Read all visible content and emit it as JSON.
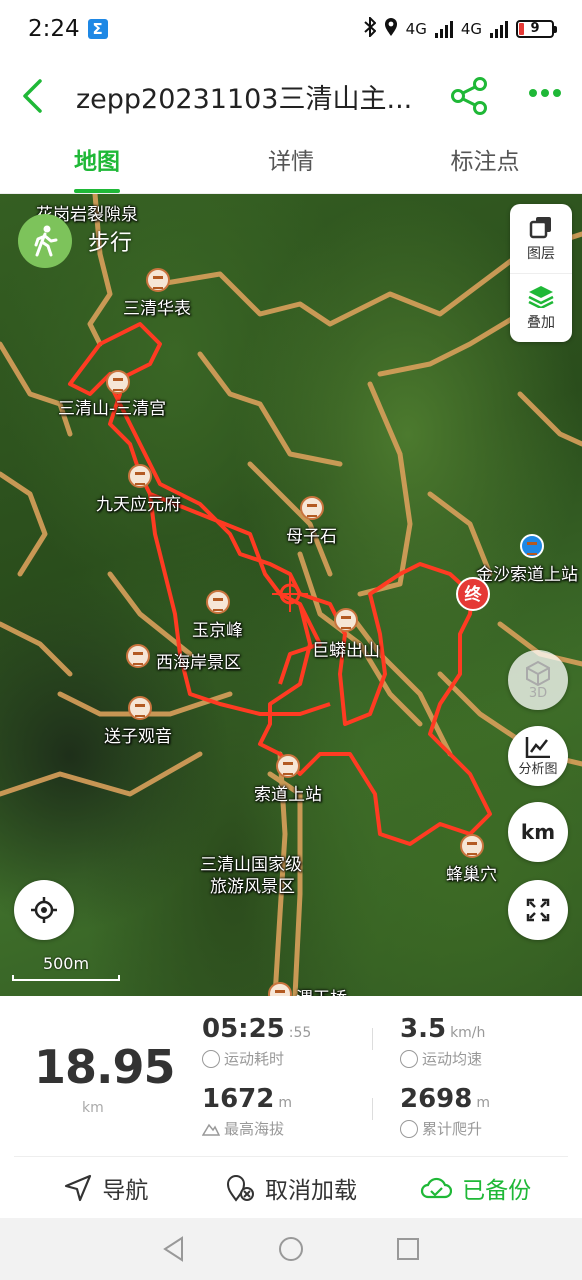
{
  "status_bar": {
    "time": "2:24",
    "net1": "4G",
    "net2": "4G",
    "battery": "9"
  },
  "header": {
    "title": "zepp20231103三清山主..."
  },
  "tabs": [
    {
      "label": "地图"
    },
    {
      "label": "详情"
    },
    {
      "label": "标注点"
    }
  ],
  "map": {
    "mode_label": "步行",
    "layers": {
      "layer_label": "图层",
      "overlay_label": "叠加"
    },
    "pois": [
      "花岗岩裂隙泉",
      "三清华表",
      "三清山-三清宫",
      "九天应元府",
      "母子石",
      "金沙索道上站",
      "玉京峰",
      "巨蟒出山",
      "西海岸景区",
      "送子观音",
      "索道上站",
      "三清山国家级",
      "旅游风景区",
      "蜂巢穴",
      "渭玉桥"
    ],
    "end_marker": "终",
    "buttons": {
      "three_d": "3D",
      "analysis": "分析图",
      "unit": "km"
    },
    "scale": "500m"
  },
  "stats": {
    "distance": {
      "value": "18.95",
      "unit": "km"
    },
    "duration": {
      "value": "05:25",
      "seconds": ":55",
      "label": "运动耗时"
    },
    "avg_speed": {
      "value": "3.5",
      "unit": "km/h",
      "label": "运动均速"
    },
    "max_altitude": {
      "value": "1672",
      "unit": "m",
      "label": "最高海拔"
    },
    "total_climb": {
      "value": "2698",
      "unit": "m",
      "label": "累计爬升"
    }
  },
  "actions": {
    "navigate": "导航",
    "cancel_load": "取消加载",
    "backed_up": "已备份"
  },
  "colors": {
    "accent": "#1fb837",
    "route": "#e53935",
    "trail": "#d9a05b"
  }
}
